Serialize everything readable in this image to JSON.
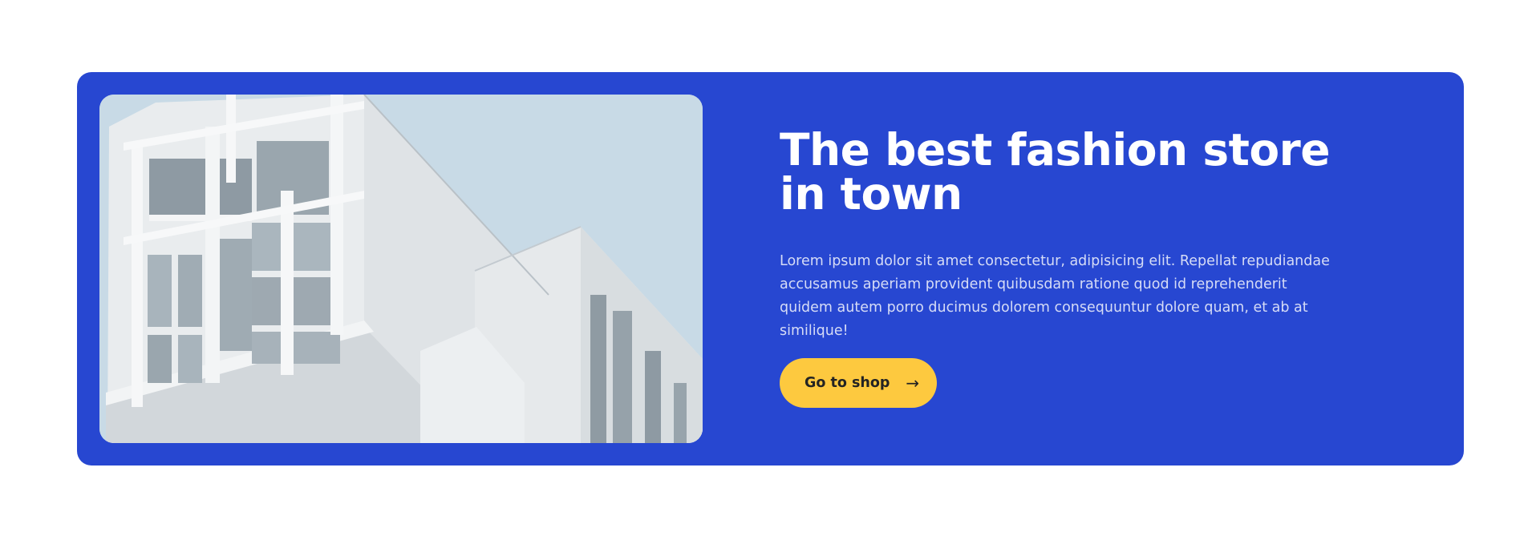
{
  "hero": {
    "title": "The best fashion store in town",
    "description": "Lorem ipsum dolor sit amet consectetur, adipisicing elit. Repellat repudiandae accusamus aperiam provident quibusdam ratione quod id reprehenderit quidem autem porro ducimus dolorem consequuntur dolore quam, et ab at similique!",
    "cta_label": "Go to shop",
    "cta_icon": "arrow-right-icon",
    "image": "white-modern-building-photo"
  },
  "colors": {
    "hero_background": "#2747d1",
    "title_text": "#ffffff",
    "description_text": "#d6dcf6",
    "button_background": "#fdc93f",
    "button_text": "#232323",
    "sky": "#c8dae6"
  }
}
